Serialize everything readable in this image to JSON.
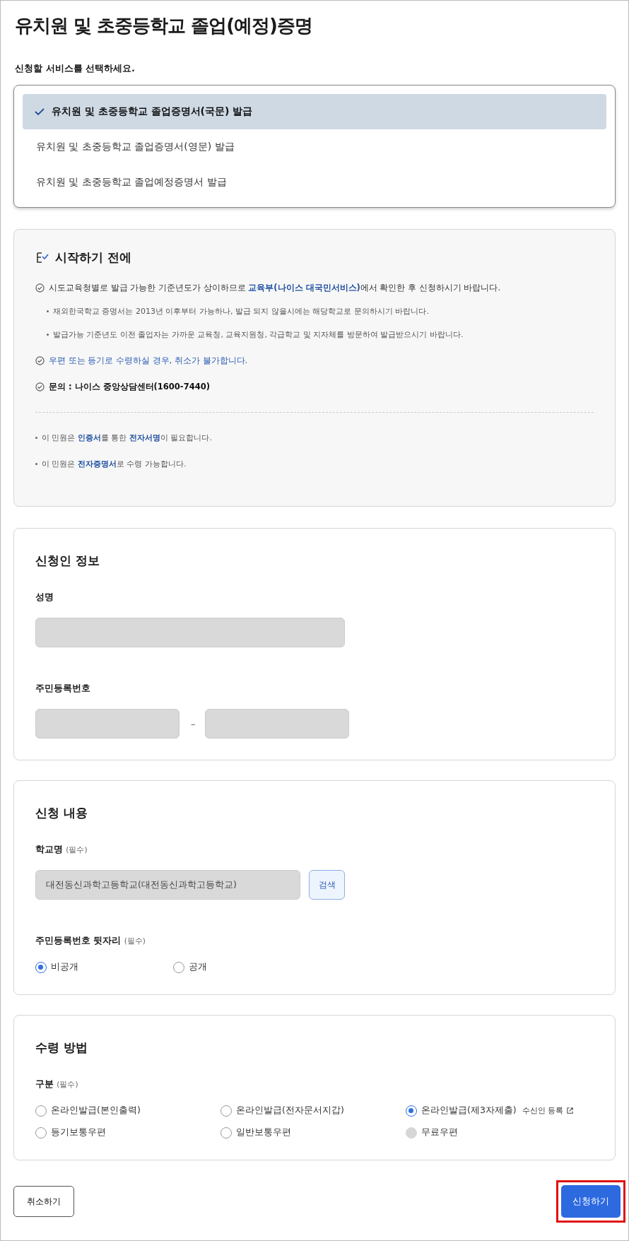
{
  "title": "유치원 및 초중등학교 졸업(예정)증명",
  "service_prompt": "신청할 서비스를 선택하세요.",
  "services": [
    {
      "label": "유치원 및 초중등학교 졸업증명서(국문) 발급",
      "selected": true
    },
    {
      "label": "유치원 및 초중등학교 졸업증명서(영문) 발급",
      "selected": false
    },
    {
      "label": "유치원 및 초중등학교 졸업예정증명서 발급",
      "selected": false
    }
  ],
  "before_start": {
    "title": "시작하기 전에",
    "checks": [
      {
        "kind": "plain",
        "text": "시도교육청별로 발급 가능한 기준년도가 상이하므로 **교육부(나이스 대국민서비스)**에서 확인한 후 신청하시기 바랍니다.",
        "children": [
          "재외한국학교 증명서는 2013년 이후부터 가능하나, 발급 되지 않을시에는 해당학교로 문의하시기 바랍니다.",
          "발급가능 기준년도 이전 졸업자는 가까운 교육청, 교육지원청, 각급학교 및 지자체를 방문하여 발급받으시기 바랍니다."
        ]
      },
      {
        "kind": "warning",
        "text": "우편 또는 등기로 수령하실 경우, 취소가 불가합니다."
      },
      {
        "kind": "strong",
        "text": "문의 : 나이스 중앙상담센터(1600-7440)"
      }
    ],
    "notes": [
      "이 민원은 **인증서**를 통한 **전자서명**이 필요합니다.",
      "이 민원은 **전자증명서**로 수령 가능합니다."
    ]
  },
  "applicant": {
    "title": "신청인 정보",
    "name_label": "성명",
    "rrn_label": "주민등록번호",
    "rrn_separator": "–"
  },
  "request": {
    "title": "신청 내용",
    "school_label": "학교명",
    "school_required": "(필수)",
    "school_value": "대전동신과학고등학교(대전동신과학고등학교)",
    "search_button": "검색",
    "rrn_back_label": "주민등록번호 뒷자리",
    "rrn_back_required": "(필수)",
    "disclosure": [
      {
        "label": "비공개",
        "selected": true
      },
      {
        "label": "공개",
        "selected": false
      }
    ]
  },
  "receipt": {
    "title": "수령 방법",
    "type_label": "구분",
    "type_required": "(필수)",
    "options": [
      {
        "label": "온라인발급(본인출력)",
        "selected": false,
        "disabled": false
      },
      {
        "label": "온라인발급(전자문서지갑)",
        "selected": false,
        "disabled": false
      },
      {
        "label": "온라인발급(제3자제출)",
        "selected": true,
        "disabled": false,
        "link": "수신인 등록"
      },
      {
        "label": "등기보통우편",
        "selected": false,
        "disabled": false
      },
      {
        "label": "일반보통우편",
        "selected": false,
        "disabled": false
      },
      {
        "label": "무료우편",
        "selected": false,
        "disabled": true
      }
    ]
  },
  "buttons": {
    "cancel": "취소하기",
    "submit": "신청하기",
    "submit_highlighted": true
  }
}
